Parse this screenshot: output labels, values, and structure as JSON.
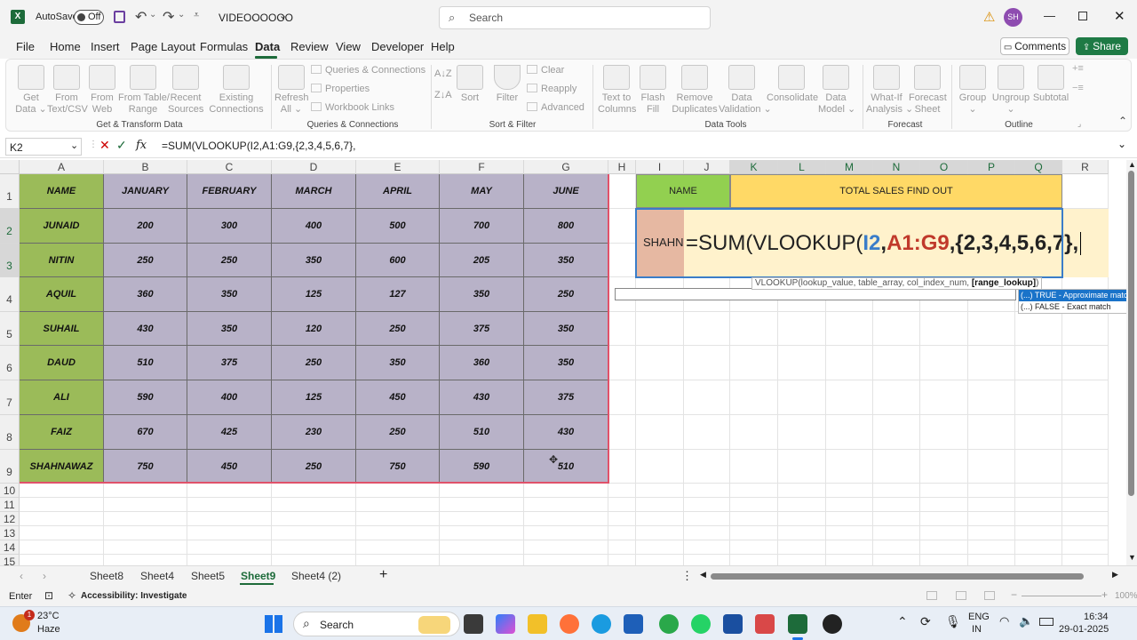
{
  "titlebar": {
    "autosave": "AutoSave",
    "autosave_state": "Off",
    "doc_name": "VIDEOOOOOO",
    "search_placeholder": "Search",
    "avatar": "SH"
  },
  "menu": [
    "File",
    "Home",
    "Insert",
    "Page Layout",
    "Formulas",
    "Data",
    "Review",
    "View",
    "Developer",
    "Help"
  ],
  "menu_active": "Data",
  "comments_label": "Comments",
  "share_label": "Share",
  "ribbon": {
    "get_data": "Get\nData ⌄",
    "from_text": "From\nText/CSV",
    "from_web": "From\nWeb",
    "from_table": "From Table/\nRange",
    "recent": "Recent\nSources",
    "existing": "Existing\nConnections",
    "group_get": "Get & Transform Data",
    "refresh": "Refresh\nAll ⌄",
    "queries_conn": "Queries & Connections",
    "properties": "Properties",
    "workbook_links": "Workbook Links",
    "group_queries": "Queries & Connections",
    "sort": "Sort",
    "filter": "Filter",
    "clear": "Clear",
    "reapply": "Reapply",
    "advanced": "Advanced",
    "group_sort": "Sort & Filter",
    "text_to_columns": "Text to\nColumns",
    "flash_fill": "Flash\nFill",
    "remove_dup": "Remove\nDuplicates",
    "data_validation": "Data\nValidation ⌄",
    "consolidate": "Consolidate",
    "data_model": "Data\nModel ⌄",
    "group_tools": "Data Tools",
    "what_if": "What-If\nAnalysis ⌄",
    "forecast_sheet": "Forecast\nSheet",
    "group_forecast": "Forecast",
    "group_btn": "Group\n⌄",
    "ungroup": "Ungroup\n⌄",
    "subtotal": "Subtotal",
    "group_outline": "Outline"
  },
  "formula_bar": {
    "name_box": "K2",
    "fx": "fx",
    "formula": "=SUM(VLOOKUP(I2,A1:G9,{2,3,4,5,6,7},"
  },
  "columns": [
    "A",
    "B",
    "C",
    "D",
    "E",
    "F",
    "G",
    "H",
    "I",
    "J",
    "K",
    "L",
    "M",
    "N",
    "O",
    "P",
    "Q",
    "R"
  ],
  "rows": [
    "1",
    "2",
    "3",
    "4",
    "5",
    "6",
    "7",
    "8",
    "9",
    "10",
    "11",
    "12",
    "13",
    "14",
    "15"
  ],
  "table": {
    "headers": [
      "NAME",
      "JANUARY",
      "FEBRUARY",
      "MARCH",
      "APRIL",
      "MAY",
      "JUNE"
    ],
    "rows": [
      [
        "JUNAID",
        "200",
        "300",
        "400",
        "500",
        "700",
        "800"
      ],
      [
        "NITIN",
        "250",
        "250",
        "350",
        "600",
        "205",
        "350"
      ],
      [
        "AQUIL",
        "360",
        "350",
        "125",
        "127",
        "350",
        "250"
      ],
      [
        "SUHAIL",
        "430",
        "350",
        "120",
        "250",
        "375",
        "350"
      ],
      [
        "DAUD",
        "510",
        "375",
        "250",
        "350",
        "360",
        "350"
      ],
      [
        "ALI",
        "590",
        "400",
        "125",
        "450",
        "430",
        "375"
      ],
      [
        "FAIZ",
        "670",
        "425",
        "230",
        "250",
        "510",
        "430"
      ],
      [
        "SHAHNAWAZ",
        "750",
        "450",
        "250",
        "750",
        "590",
        "510"
      ]
    ]
  },
  "lookup": {
    "name_header": "NAME",
    "total_header": "TOTAL SALES FIND OUT",
    "name_value": "SHAHN",
    "f_eq": "=SUM(VLOOKUP(",
    "f_i2": "I2",
    ",1": ",",
    "f_range": "A1:G9",
    "f_rest": ",{2,3,4,5,6,7},"
  },
  "tooltip": {
    "prefix": "VLOOKUP(lookup_value, table_array, col_index_num, ",
    "current": "[range_lookup]",
    "suffix": ")"
  },
  "autocomplete": [
    {
      "icon": "(...)",
      "text": "TRUE - Approximate match"
    },
    {
      "icon": "(...)",
      "text": "FALSE - Exact match"
    }
  ],
  "sheets": [
    "Sheet8",
    "Sheet4",
    "Sheet5",
    "Sheet9",
    "Sheet4 (2)"
  ],
  "active_sheet": "Sheet9",
  "status": {
    "mode": "Enter",
    "accessibility": "Accessibility: Investigate",
    "zoom": "100%"
  },
  "taskbar": {
    "weather_temp": "23°C",
    "weather_desc": "Haze",
    "badge": "1",
    "search": "Search",
    "lang1": "ENG",
    "lang2": "IN",
    "time": "16:34",
    "date": "29-01-2025"
  },
  "colors": {
    "excel_green": "#1d6b3a",
    "name_col": "#9bbb59",
    "data_fill": "#b8b2c8",
    "name_hdr": "#92d050",
    "total_hdr": "#ffd966",
    "name_cell": "#e6b8a2",
    "formula_cell": "#fff2cc",
    "share": "#1e7a45"
  }
}
